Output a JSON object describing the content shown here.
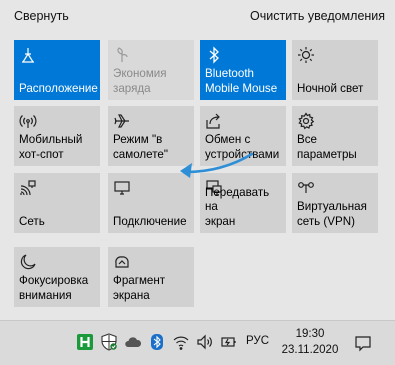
{
  "header": {
    "collapse_label": "Свернуть",
    "clear_label": "Очистить уведомления"
  },
  "colors": {
    "accent": "#0078d7",
    "tile": "#d1d1d1",
    "tile_disabled": "#d9d9d9",
    "background": "#e6e6e6"
  },
  "tiles": [
    {
      "label": "Расположение",
      "icon": "location-icon",
      "state": "on"
    },
    {
      "label": "Экономия\nзаряда",
      "icon": "battery-saver-icon",
      "state": "disabled"
    },
    {
      "label": "Bluetooth\nMobile Mouse",
      "icon": "bluetooth-icon",
      "state": "on"
    },
    {
      "label": "Ночной свет",
      "icon": "brightness-icon",
      "state": "off"
    },
    {
      "label": "Мобильный\nхот-спот",
      "icon": "hotspot-icon",
      "state": "off"
    },
    {
      "label": "Режим \"в\nсамолете\"",
      "icon": "airplane-icon",
      "state": "off"
    },
    {
      "label": "Обмен с\nустройствами",
      "icon": "share-icon",
      "state": "off"
    },
    {
      "label": "Все\nпараметры",
      "icon": "settings-gear-icon",
      "state": "off"
    },
    {
      "label": "Сеть",
      "icon": "network-icon",
      "state": "off"
    },
    {
      "label": "Подключение",
      "icon": "connect-icon",
      "state": "off"
    },
    {
      "label": "Передавать на\nэкран",
      "icon": "project-icon",
      "state": "off"
    },
    {
      "label": "Виртуальная\nсеть (VPN)",
      "icon": "vpn-icon",
      "state": "off"
    },
    {
      "label": "Фокусировка\nвнимания",
      "icon": "focus-moon-icon",
      "state": "off"
    },
    {
      "label": "Фрагмент\nэкрана",
      "icon": "snip-icon",
      "state": "off"
    }
  ],
  "taskbar": {
    "tray_icons": [
      "app-h-icon",
      "defender-shield-icon",
      "onedrive-cloud-icon",
      "bluetooth-tray-icon",
      "wifi-icon",
      "volume-icon",
      "battery-icon"
    ],
    "language": "РУС",
    "time": "19:30",
    "date": "23.11.2020",
    "notification_icon": "action-center-icon"
  }
}
